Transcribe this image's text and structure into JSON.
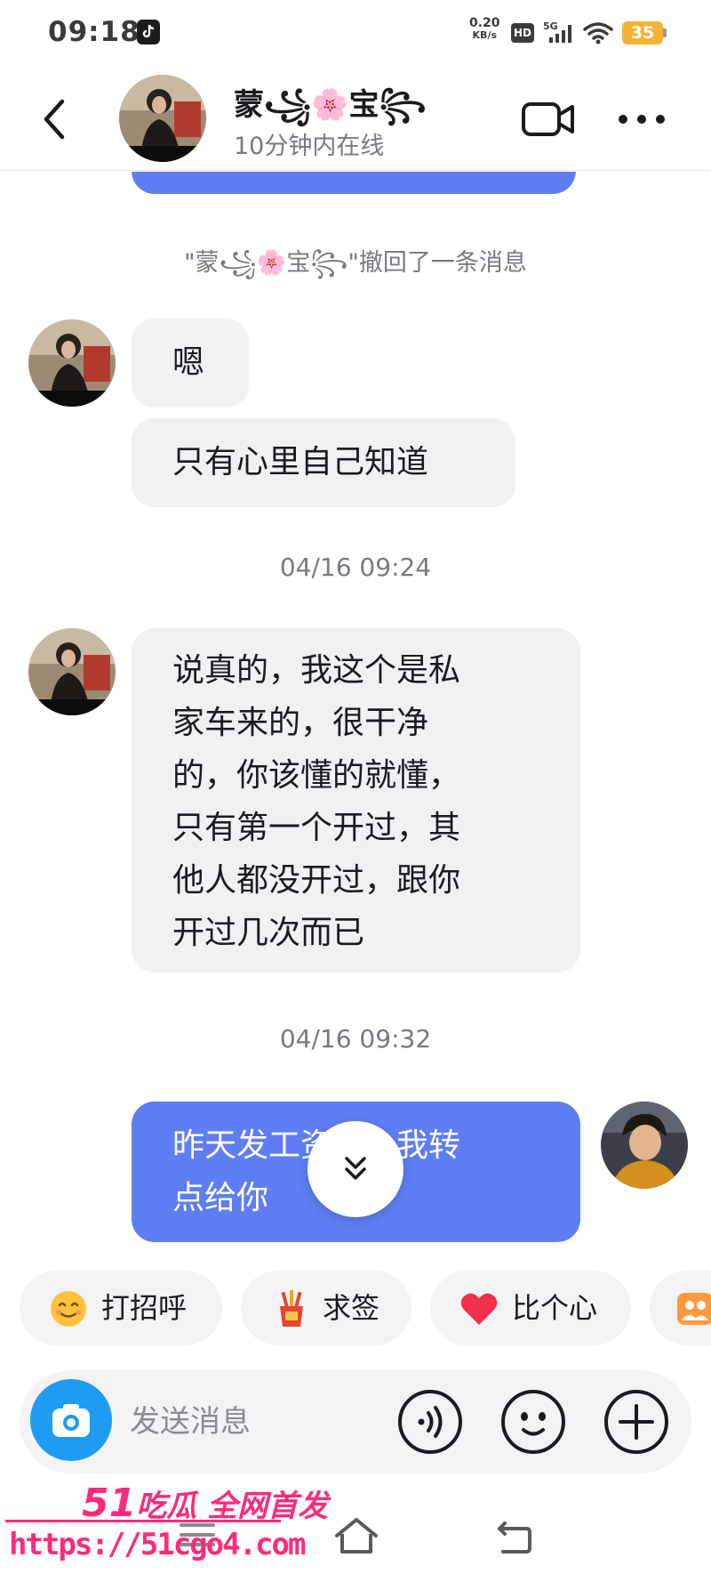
{
  "status_bar": {
    "time": "09:18",
    "net_speed_value": "0.20",
    "net_speed_unit": "KB/s",
    "hd_label": "HD",
    "network_label": "5G",
    "battery": "35",
    "battery_color": "#f5b335"
  },
  "header": {
    "contact_name": "蒙꧁🌸宝꧂",
    "contact_status": "10分钟内在线",
    "icons": [
      "back-arrow-icon",
      "video-call-icon",
      "more-icon"
    ]
  },
  "chat": {
    "recall_notice": "\"蒙꧁🌸宝꧂\"撤回了一条消息",
    "messages": [
      {
        "direction": "in",
        "text": "嗯"
      },
      {
        "direction": "in",
        "text": "只有心里自己知道"
      },
      {
        "timestamp": "04/16 09:24"
      },
      {
        "direction": "in",
        "lines": [
          "说真的，我这个是私",
          "家车来的，很干净",
          "的，你该懂的就懂，",
          "只有第一个开过，其",
          "他人都没开过，跟你",
          "开过几次而已"
        ]
      },
      {
        "timestamp": "04/16 09:32"
      },
      {
        "direction": "out",
        "lines": [
          "昨天发工资了，我转",
          "点给你"
        ]
      }
    ],
    "outgoing_bubble_color": "#5f7ef3",
    "incoming_bubble_color": "#f1f1f4"
  },
  "quick_replies": [
    {
      "label": "打招呼",
      "icon": "smiling-emoji-icon"
    },
    {
      "label": "求签",
      "icon": "fortune-sticks-icon"
    },
    {
      "label": "比个心",
      "icon": "red-heart-icon"
    },
    {
      "label": "",
      "icon": "group-icon"
    }
  ],
  "input_bar": {
    "placeholder": "发送消息",
    "icons": [
      "camera-icon",
      "voice-icon",
      "emoji-icon",
      "plus-icon"
    ],
    "camera_color": "#1f9bf3"
  },
  "watermark": {
    "title_num": "51",
    "title_text": "吃瓜 全网首发",
    "url": "https://51cgo4.com",
    "color": "#ff2a7a"
  }
}
